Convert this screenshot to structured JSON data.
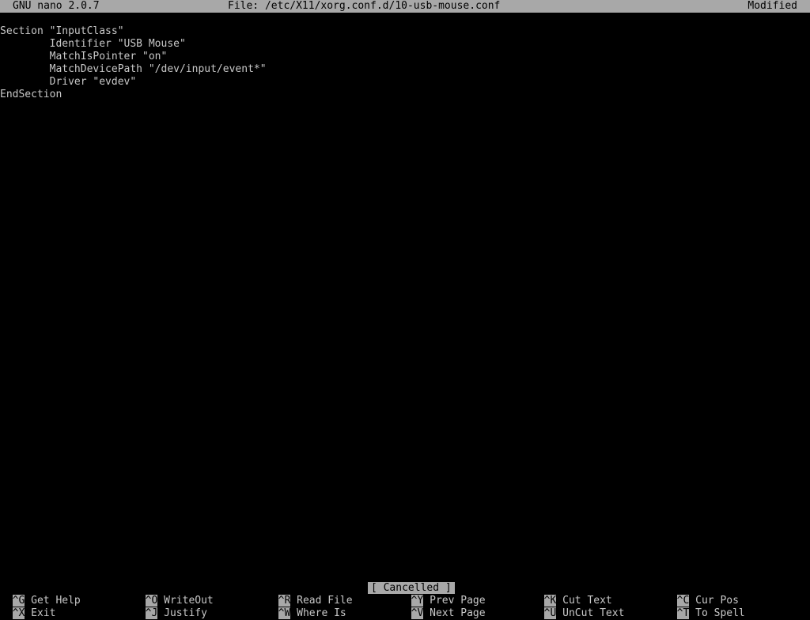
{
  "titlebar": {
    "app": "GNU nano 2.0.7",
    "file": "File: /etc/X11/xorg.conf.d/10-usb-mouse.conf",
    "status": "Modified"
  },
  "editor": {
    "lines": [
      "Section \"InputClass\"",
      "        Identifier \"USB Mouse\"",
      "        MatchIsPointer \"on\"",
      "        MatchDevicePath \"/dev/input/event*\"",
      "        Driver \"evdev\"",
      "EndSection"
    ]
  },
  "statusbar": {
    "message": "[ Cancelled ]"
  },
  "shortcuts": {
    "row1": [
      {
        "key": "^G",
        "label": "Get Help"
      },
      {
        "key": "^O",
        "label": "WriteOut"
      },
      {
        "key": "^R",
        "label": "Read File"
      },
      {
        "key": "^Y",
        "label": "Prev Page"
      },
      {
        "key": "^K",
        "label": "Cut Text"
      },
      {
        "key": "^C",
        "label": "Cur Pos"
      }
    ],
    "row2": [
      {
        "key": "^X",
        "label": "Exit"
      },
      {
        "key": "^J",
        "label": "Justify"
      },
      {
        "key": "^W",
        "label": "Where Is"
      },
      {
        "key": "^V",
        "label": "Next Page"
      },
      {
        "key": "^U",
        "label": "UnCut Text"
      },
      {
        "key": "^T",
        "label": "To Spell"
      }
    ]
  },
  "colors": {
    "background": "#000000",
    "foreground": "#c8c8c8",
    "inverse_background": "#a8a8a8",
    "inverse_foreground": "#000000"
  }
}
